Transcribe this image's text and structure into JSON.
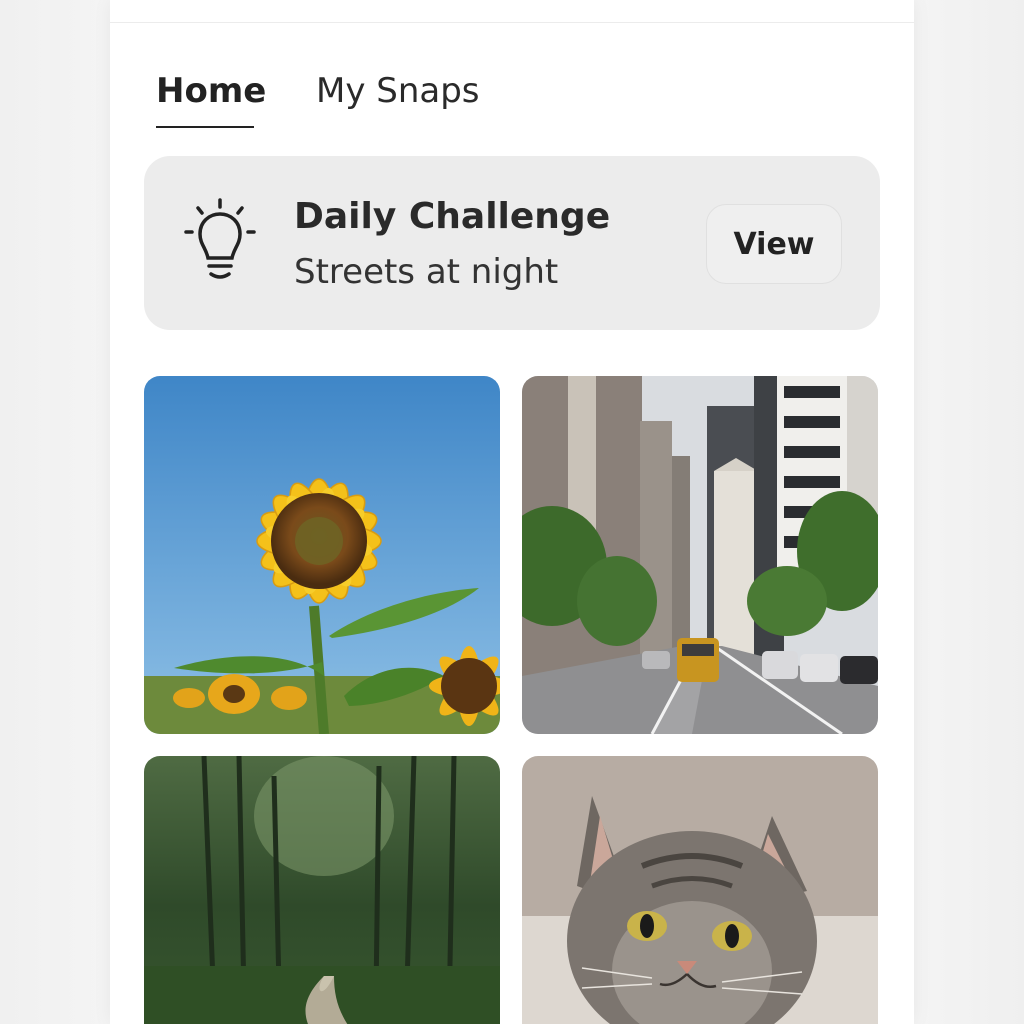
{
  "tabs": [
    {
      "label": "Home",
      "active": true
    },
    {
      "label": "My Snaps",
      "active": false
    }
  ],
  "challenge": {
    "title": "Daily Challenge",
    "subtitle": "Streets at night",
    "view_label": "View",
    "icon": "lightbulb-icon"
  },
  "photos": [
    {
      "name": "sunflower-photo"
    },
    {
      "name": "city-street-photo"
    },
    {
      "name": "forest-path-photo"
    },
    {
      "name": "cat-photo"
    }
  ],
  "colors": {
    "background": "#ffffff",
    "card": "#ececec",
    "text": "#222222"
  }
}
